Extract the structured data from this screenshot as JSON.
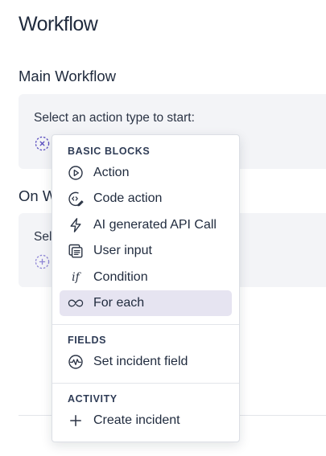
{
  "page": {
    "title": "Workflow"
  },
  "sections": [
    {
      "title": "Main Workflow",
      "prompt": "Select an action type to start:"
    },
    {
      "title": "On W",
      "prompt": "Sel"
    }
  ],
  "menu": {
    "groups": [
      {
        "header": "BASIC BLOCKS",
        "items": [
          {
            "label": "Action",
            "icon": "play-circle-icon"
          },
          {
            "label": "Code action",
            "icon": "code-action-icon"
          },
          {
            "label": "AI generated API Call",
            "icon": "lightning-icon"
          },
          {
            "label": "User input",
            "icon": "form-icon"
          },
          {
            "label": "Condition",
            "icon": "if-icon"
          },
          {
            "label": "For each",
            "icon": "loop-icon",
            "selected": true
          }
        ]
      },
      {
        "header": "FIELDS",
        "items": [
          {
            "label": "Set incident field",
            "icon": "activity-circle-icon"
          }
        ]
      },
      {
        "header": "ACTIVITY",
        "items": [
          {
            "label": "Create incident",
            "icon": "plus-icon"
          }
        ]
      }
    ],
    "condition_glyph": "if",
    "selected_bg": "#e6e4f1"
  },
  "colors": {
    "accent": "#5b4fbf"
  }
}
